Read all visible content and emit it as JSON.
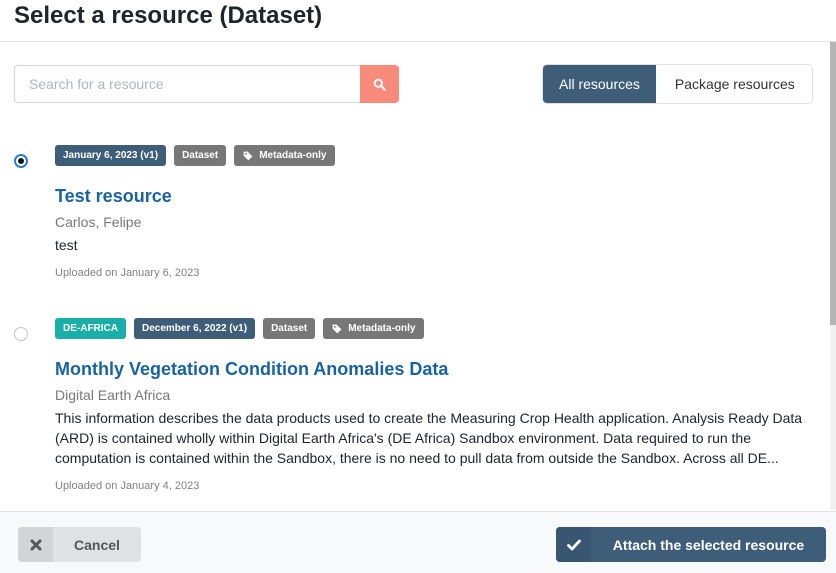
{
  "modal": {
    "title": "Select a resource (Dataset)"
  },
  "search": {
    "placeholder": "Search for a resource",
    "value": "",
    "button_icon": "search-icon"
  },
  "filter_toggle": {
    "options": [
      {
        "label": "All resources",
        "active": true
      },
      {
        "label": "Package resources",
        "active": false
      }
    ]
  },
  "resources": [
    {
      "selected": true,
      "badges": {
        "date": "January 6, 2023 (v1)",
        "type": "Dataset",
        "access": "Metadata-only"
      },
      "title": "Test resource",
      "creators": "Carlos, Felipe",
      "description": "test",
      "uploaded": "Uploaded on January 6, 2023"
    },
    {
      "selected": false,
      "badges": {
        "community": "DE-AFRICA",
        "date": "December 6, 2022 (v1)",
        "type": "Dataset",
        "access": "Metadata-only"
      },
      "title": "Monthly Vegetation Condition Anomalies Data",
      "creators": "Digital Earth Africa",
      "description": "This information describes the data products used to create the Measuring Crop Health application. Analysis Ready Data (ARD) is contained wholly within Digital Earth Africa's (DE Africa) Sandbox environment. Data required to run the computation is contained within the Sandbox, there is no need to pull data from outside the Sandbox. Across all DE...",
      "uploaded": "Uploaded on January 4, 2023"
    }
  ],
  "footer": {
    "cancel_label": "Cancel",
    "attach_label": "Attach the selected resource"
  },
  "colors": {
    "primary": "#3e5d78",
    "search_button": "#f98b7a",
    "link": "#1a62a0",
    "community_badge": "#1aaea9",
    "neutral_badge": "#777777"
  }
}
